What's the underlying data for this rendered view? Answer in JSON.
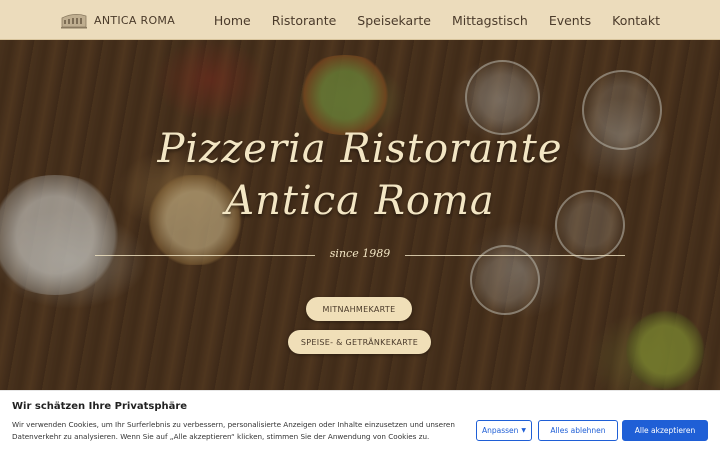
{
  "header": {
    "brand": "ANTICA ROMA",
    "nav": [
      "Home",
      "Ristorante",
      "Speisekarte",
      "Mittagstisch",
      "Events",
      "Kontakt"
    ]
  },
  "hero": {
    "title_line1": "Pizzeria Ristorante",
    "title_line2": "Antica Roma",
    "since": "since 1989",
    "buttons": {
      "takeaway": "MITNAHMEKARTE",
      "menu": "SPEISE- & GETRÄNKEKARTE"
    }
  },
  "cookie_banner": {
    "title": "Wir schätzen Ihre Privatsphäre",
    "text": "Wir verwenden Cookies, um Ihr Surferlebnis zu verbessern, personalisierte Anzeigen oder Inhalte einzusetzen und unseren Datenverkehr zu analysieren. Wenn Sie auf „Alle akzeptieren“ klicken, stimmen Sie der Anwendung von Cookies zu.",
    "customize": "Anpassen",
    "reject": "Alles ablehnen",
    "accept": "Alle akzeptieren"
  },
  "colors": {
    "header_bg": "#ecdcbc",
    "title": "#f3e6c4",
    "pill_bg": "#f0dfb8",
    "accent_blue": "#1f5fd6"
  },
  "icons": {
    "logo": "colosseum-icon",
    "dropdown": "caret-down-icon"
  }
}
